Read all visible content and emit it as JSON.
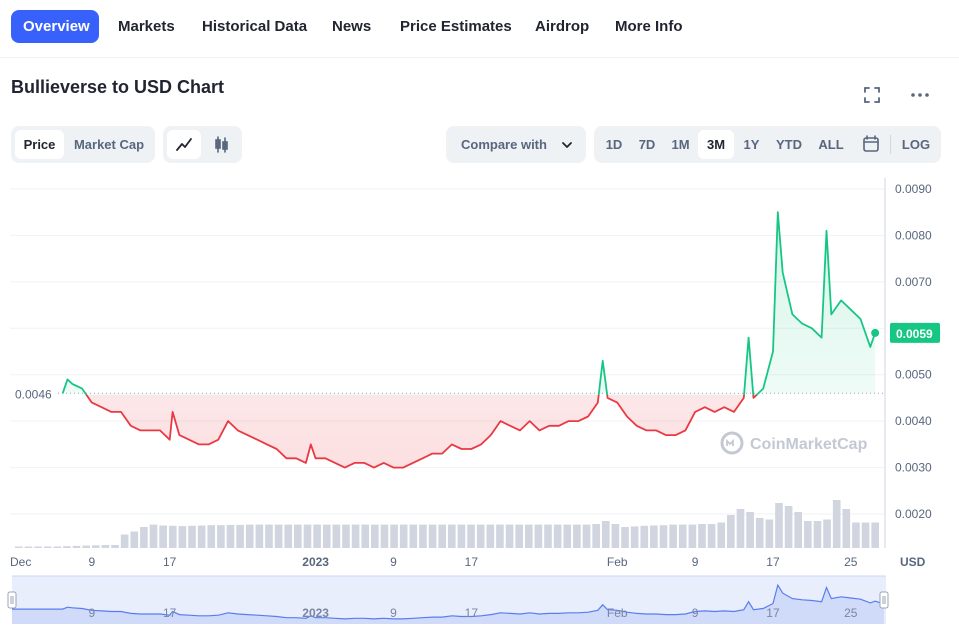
{
  "nav": {
    "tabs": [
      {
        "label": "Overview",
        "active": true
      },
      {
        "label": "Markets"
      },
      {
        "label": "Historical Data"
      },
      {
        "label": "News"
      },
      {
        "label": "Price Estimates"
      },
      {
        "label": "Airdrop"
      },
      {
        "label": "More Info"
      }
    ]
  },
  "title": "Bullieverse to USD Chart",
  "toolbar": {
    "metric": {
      "price": "Price",
      "market_cap": "Market Cap",
      "selected": "Price"
    },
    "chart_style": {
      "line": "line-chart-icon",
      "candles": "candlestick-icon",
      "selected": "line"
    },
    "compare_label": "Compare with",
    "ranges": [
      "1D",
      "7D",
      "1M",
      "3M",
      "1Y",
      "YTD",
      "ALL"
    ],
    "selected_range": "3M",
    "log_label": "LOG"
  },
  "icons": {
    "fullscreen": "fullscreen-icon",
    "more": "more-icon",
    "calendar": "calendar-icon"
  },
  "colors": {
    "accent": "#3861fb",
    "up": "#16c784",
    "down": "#ea3943",
    "volume": "#d1d5e0"
  },
  "watermark": "CoinMarketCap",
  "chart_data": {
    "type": "line",
    "title": "",
    "currency": "USD",
    "open_price": 0.0046,
    "open_price_label": "0.0046",
    "current_price": 0.0059,
    "current_price_label": "0.0059",
    "ylim": [
      0.0018,
      0.0092
    ],
    "y_ticks": [
      "0.0090",
      "0.0080",
      "0.0070",
      "0.0060",
      "0.0050",
      "0.0040",
      "0.0030",
      "0.0020"
    ],
    "y_tick_values": [
      0.009,
      0.008,
      0.007,
      0.006,
      0.005,
      0.004,
      0.003,
      0.002
    ],
    "x_ticks": [
      {
        "label": "Dec",
        "day": 0,
        "bold": false
      },
      {
        "label": "9",
        "day": 8,
        "bold": false
      },
      {
        "label": "17",
        "day": 16,
        "bold": false
      },
      {
        "label": "2023",
        "day": 31,
        "bold": true
      },
      {
        "label": "9",
        "day": 39,
        "bold": false
      },
      {
        "label": "17",
        "day": 47,
        "bold": false
      },
      {
        "label": "Feb",
        "day": 62,
        "bold": false
      },
      {
        "label": "9",
        "day": 70,
        "bold": false
      },
      {
        "label": "17",
        "day": 78,
        "bold": false
      },
      {
        "label": "25",
        "day": 86,
        "bold": false
      }
    ],
    "x_domain_days": [
      0,
      89
    ],
    "series": [
      {
        "x_days": [
          5,
          5.5,
          6,
          7,
          8,
          9,
          10,
          11,
          12,
          13,
          14,
          15,
          16,
          16.3,
          17,
          18,
          19,
          20,
          21,
          22,
          23,
          24,
          25,
          26,
          27,
          28,
          29,
          30,
          30.5,
          31,
          32,
          33,
          34,
          35,
          36,
          37,
          38,
          39,
          40,
          41,
          42,
          43,
          44,
          45,
          46,
          47,
          48,
          49,
          50,
          51,
          52,
          53,
          54,
          55,
          56,
          57,
          58,
          59,
          60,
          60.5,
          61,
          62,
          63,
          64,
          65,
          66,
          67,
          68,
          69,
          70,
          71,
          72,
          73,
          74,
          75,
          75.5,
          76,
          77,
          78,
          78.5,
          79,
          80,
          81,
          82,
          83,
          83.5,
          84,
          85,
          86,
          87,
          88,
          88.5
        ],
        "y": [
          0.0046,
          0.0049,
          0.0048,
          0.0047,
          0.0044,
          0.0043,
          0.0042,
          0.0042,
          0.0039,
          0.0038,
          0.0038,
          0.0038,
          0.0036,
          0.0042,
          0.0037,
          0.0036,
          0.0035,
          0.0035,
          0.0036,
          0.004,
          0.0038,
          0.0037,
          0.0036,
          0.0035,
          0.0034,
          0.0032,
          0.0032,
          0.0031,
          0.0035,
          0.0032,
          0.0032,
          0.0031,
          0.003,
          0.0031,
          0.0031,
          0.003,
          0.0031,
          0.003,
          0.003,
          0.0031,
          0.0032,
          0.0033,
          0.0033,
          0.0035,
          0.0034,
          0.0034,
          0.0035,
          0.0037,
          0.004,
          0.0039,
          0.0038,
          0.004,
          0.0038,
          0.0039,
          0.0039,
          0.004,
          0.004,
          0.0041,
          0.0044,
          0.0053,
          0.0045,
          0.0044,
          0.0041,
          0.0039,
          0.0038,
          0.0038,
          0.0037,
          0.0037,
          0.0038,
          0.0042,
          0.0043,
          0.0042,
          0.0043,
          0.0042,
          0.0045,
          0.0058,
          0.0045,
          0.0047,
          0.0055,
          0.0085,
          0.0072,
          0.0063,
          0.0061,
          0.006,
          0.0058,
          0.0081,
          0.0063,
          0.0066,
          0.0064,
          0.0062,
          0.0056,
          0.0059
        ]
      }
    ],
    "volume_relative": [
      0.05,
      0.05,
      0.05,
      0.05,
      0.05,
      0.06,
      0.07,
      0.08,
      0.09,
      0.1,
      0.1,
      0.45,
      0.55,
      0.7,
      0.78,
      0.75,
      0.74,
      0.73,
      0.74,
      0.75,
      0.76,
      0.76,
      0.77,
      0.77,
      0.78,
      0.78,
      0.78,
      0.78,
      0.78,
      0.78,
      0.78,
      0.78,
      0.78,
      0.78,
      0.78,
      0.78,
      0.78,
      0.78,
      0.78,
      0.78,
      0.78,
      0.78,
      0.78,
      0.78,
      0.78,
      0.78,
      0.78,
      0.78,
      0.78,
      0.78,
      0.78,
      0.78,
      0.78,
      0.78,
      0.78,
      0.78,
      0.78,
      0.78,
      0.78,
      0.78,
      0.8,
      0.9,
      0.8,
      0.7,
      0.72,
      0.74,
      0.75,
      0.76,
      0.78,
      0.78,
      0.78,
      0.8,
      0.8,
      0.85,
      1.1,
      1.3,
      1.2,
      1.0,
      0.95,
      1.5,
      1.4,
      1.2,
      0.9,
      0.9,
      0.95,
      1.6,
      1.3,
      0.85,
      0.85,
      0.85
    ],
    "navigator_ticks": [
      "9",
      "17",
      "2023",
      "9",
      "17",
      "Feb",
      "9",
      "17",
      "25"
    ]
  }
}
